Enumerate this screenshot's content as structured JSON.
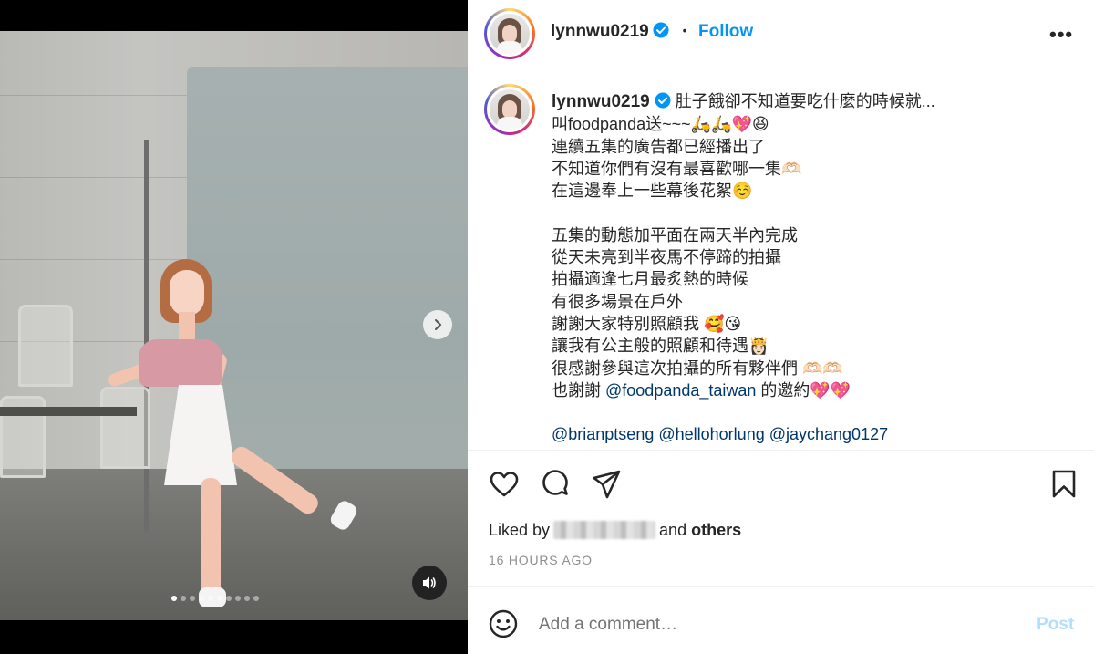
{
  "post": {
    "username": "lynnwu0219",
    "follow_label": "Follow",
    "separator": "•",
    "more_label": "•••"
  },
  "caption": {
    "username": "lynnwu0219",
    "lines": [
      "肚子餓卻不知道要吃什麼的時候就...",
      "叫foodpanda送~~~🛵🛵💖😆",
      "連續五集的廣告都已經播出了",
      "不知道你們有沒有最喜歡哪一集🫶🏻",
      "在這邊奉上一些幕後花絮☺️",
      "",
      "五集的動態加平面在兩天半內完成",
      "從天未亮到半夜馬不停蹄的拍攝",
      "拍攝適逢七月最炙熱的時候",
      "有很多場景在戶外",
      "謝謝大家特別照顧我 🥰😘",
      "讓我有公主般的照顧和待遇👸🏻",
      "很感謝參與這次拍攝的所有夥伴們 🫶🏻🫶🏻"
    ],
    "thanks_prefix": "也謝謝 ",
    "thanks_mention": "@foodpanda_taiwan",
    "thanks_suffix": " 的邀約💖💖",
    "tags": [
      "@brianptseng",
      "@hellohorlung",
      "@jaychang0127"
    ]
  },
  "engagement": {
    "liked_by_prefix": "Liked by",
    "liked_by_and": "and",
    "liked_by_others": "others",
    "timestamp": "16 HOURS AGO"
  },
  "comment": {
    "placeholder": "Add a comment…",
    "post_label": "Post"
  },
  "media": {
    "slide_count": 10,
    "active_slide": 1
  },
  "colors": {
    "accent": "#0095f6",
    "mention": "#00376b",
    "post_disabled": "#b2dffc",
    "muted": "#8e8e8e"
  },
  "icons": [
    "verified-badge-icon",
    "more-options-icon",
    "heart-icon",
    "comment-icon",
    "share-icon",
    "bookmark-icon",
    "emoji-icon",
    "chevron-right-icon",
    "speaker-icon"
  ]
}
